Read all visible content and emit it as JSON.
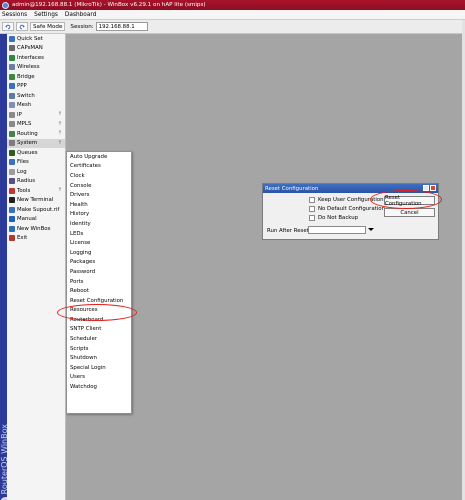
{
  "window": {
    "title": "admin@192.168.88.1 (MikroTik) - WinBox v6.29.1 on hAP lite (smips)"
  },
  "menubar": {
    "items": [
      "Sessions",
      "Settings",
      "Dashboard"
    ]
  },
  "toolbar": {
    "undo_icon": "undo-icon",
    "redo_icon": "redo-icon",
    "safe_mode_label": "Safe Mode",
    "session_label": "Session:",
    "session_value": "192.168.88.1"
  },
  "brand": {
    "vertical_text": "RouterOS WinBox"
  },
  "sidebar": {
    "items": [
      {
        "label": "Quick Set",
        "icon": "quick-set-icon"
      },
      {
        "label": "CAPsMAN",
        "icon": "capsman-icon"
      },
      {
        "label": "Interfaces",
        "icon": "interfaces-icon"
      },
      {
        "label": "Wireless",
        "icon": "wireless-icon"
      },
      {
        "label": "Bridge",
        "icon": "bridge-icon"
      },
      {
        "label": "PPP",
        "icon": "ppp-icon"
      },
      {
        "label": "Switch",
        "icon": "switch-icon"
      },
      {
        "label": "Mesh",
        "icon": "mesh-icon"
      },
      {
        "label": "IP",
        "icon": "ip-icon",
        "submenu": true
      },
      {
        "label": "MPLS",
        "icon": "mpls-icon",
        "submenu": true
      },
      {
        "label": "Routing",
        "icon": "routing-icon",
        "submenu": true
      },
      {
        "label": "System",
        "icon": "system-icon",
        "submenu": true,
        "selected": true
      },
      {
        "label": "Queues",
        "icon": "queues-icon"
      },
      {
        "label": "Files",
        "icon": "files-icon"
      },
      {
        "label": "Log",
        "icon": "log-icon"
      },
      {
        "label": "Radius",
        "icon": "radius-icon"
      },
      {
        "label": "Tools",
        "icon": "tools-icon",
        "submenu": true
      },
      {
        "label": "New Terminal",
        "icon": "terminal-icon"
      },
      {
        "label": "Make Supout.rif",
        "icon": "supout-icon"
      },
      {
        "label": "Manual",
        "icon": "manual-icon"
      },
      {
        "label": "New WinBox",
        "icon": "winbox-icon"
      },
      {
        "label": "Exit",
        "icon": "exit-icon"
      }
    ],
    "submenu_arrow": "↑"
  },
  "system_submenu": {
    "items": [
      "Auto Upgrade",
      "Certificates",
      "Clock",
      "Console",
      "Drivers",
      "Health",
      "History",
      "Identity",
      "LEDs",
      "License",
      "Logging",
      "Packages",
      "Password",
      "Ports",
      "Reboot",
      "Reset Configuration",
      "Resources",
      "Routerboard",
      "SNTP Client",
      "Scheduler",
      "Scripts",
      "Shutdown",
      "Special Login",
      "Users",
      "Watchdog"
    ],
    "highlighted": "Reset Configuration"
  },
  "dialog": {
    "title": "Reset Configuration",
    "checkboxes": [
      {
        "label": "Keep User Configuration",
        "checked": false
      },
      {
        "label": "No Default Configuration",
        "checked": false
      },
      {
        "label": "Do Not Backup",
        "checked": false
      }
    ],
    "run_after_reset_label": "Run After Reset:",
    "run_after_reset_value": "",
    "reset_button": "Reset Configuration",
    "cancel_button": "Cancel"
  },
  "colors": {
    "titlebar": "#a9122a",
    "brand_bar": "#2b3a99",
    "workspace": "#a5a5a5",
    "dialog_title": "#2853a6",
    "annotation": "#e3201b"
  }
}
